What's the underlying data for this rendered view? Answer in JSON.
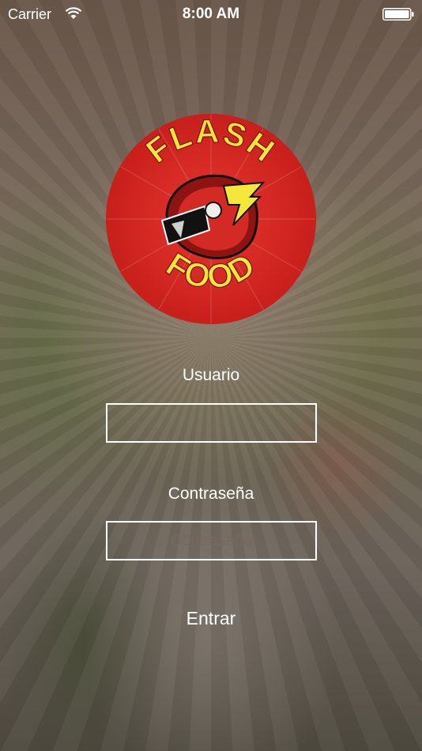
{
  "status_bar": {
    "carrier": "Carrier",
    "time": "8:00 AM",
    "wifi_icon": "wifi-icon",
    "battery_icon": "battery-icon"
  },
  "logo": {
    "line1": "FLASH",
    "line2": "FOOD",
    "badge_letter": "F",
    "colors": {
      "red": "#d42a25",
      "dark_red": "#8e1414",
      "yellow": "#f5e63a",
      "black": "#111111"
    }
  },
  "login": {
    "username_label": "Usuario",
    "username_value": "",
    "username_placeholder": "",
    "password_label": "Contraseña",
    "password_value": "",
    "password_placeholder": "Contraseña",
    "submit_label": "Entrar"
  }
}
